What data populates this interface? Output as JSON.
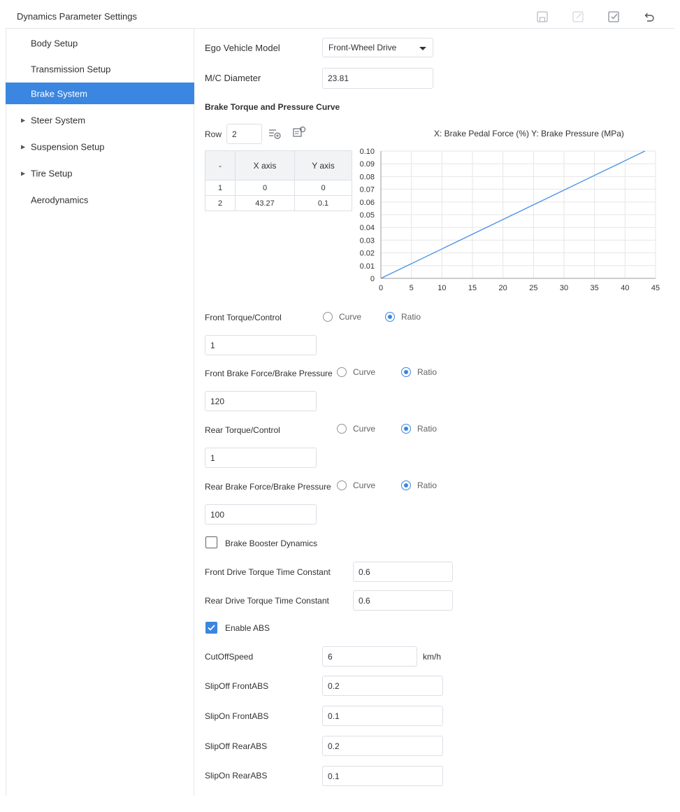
{
  "header": {
    "title": "Dynamics Parameter Settings",
    "icons": [
      "save-icon",
      "edit-icon",
      "confirm-icon",
      "undo-icon"
    ]
  },
  "sidebar": {
    "items": [
      {
        "label": "Body Setup",
        "expandable": false,
        "active": false
      },
      {
        "label": "Transmission Setup",
        "expandable": false,
        "active": false
      },
      {
        "label": "Brake System",
        "expandable": false,
        "active": true
      },
      {
        "label": "Steer System",
        "expandable": true,
        "active": false
      },
      {
        "label": "Suspension Setup",
        "expandable": true,
        "active": false
      },
      {
        "label": "Tire Setup",
        "expandable": true,
        "active": false
      },
      {
        "label": "Aerodynamics",
        "expandable": false,
        "active": false
      }
    ]
  },
  "form": {
    "ego_model": {
      "label": "Ego Vehicle Model",
      "value": "Front-Wheel Drive"
    },
    "mc_diameter": {
      "label": "M/C Diameter",
      "value": "23.81"
    },
    "curve_section": {
      "title": "Brake Torque and Pressure Curve",
      "row_label": "Row",
      "row_value": "2",
      "axis_caption": "X: Brake Pedal Force (%)  Y: Brake Pressure (MPa)",
      "table": {
        "headers": [
          "-",
          "X axis",
          "Y axis"
        ],
        "rows": [
          [
            "1",
            "0",
            "0"
          ],
          [
            "2",
            "43.27",
            "0.1"
          ]
        ]
      }
    },
    "front_torque": {
      "label": "Front Torque/Control",
      "curve": "Curve",
      "ratio": "Ratio",
      "selected": "ratio",
      "value": "1"
    },
    "front_brake_force": {
      "label": "Front Brake Force/Brake Pressure",
      "curve": "Curve",
      "ratio": "Ratio",
      "selected": "ratio",
      "value": "120"
    },
    "rear_torque": {
      "label": "Rear Torque/Control",
      "curve": "Curve",
      "ratio": "Ratio",
      "selected": "ratio",
      "value": "1"
    },
    "rear_brake_force": {
      "label": "Rear Brake Force/Brake Pressure",
      "curve": "Curve",
      "ratio": "Ratio",
      "selected": "ratio",
      "value": "100"
    },
    "booster": {
      "label": "Brake Booster Dynamics",
      "checked": false
    },
    "front_drive_tc": {
      "label": "Front Drive Torque Time Constant",
      "value": "0.6"
    },
    "rear_drive_tc": {
      "label": "Rear Drive Torque Time Constant",
      "value": "0.6"
    },
    "abs": {
      "label": "Enable ABS",
      "checked": true
    },
    "cutoff_speed": {
      "label": "CutOffSpeed",
      "value": "6",
      "unit": "km/h"
    },
    "slipoff_front": {
      "label": "SlipOff FrontABS",
      "value": "0.2"
    },
    "slipon_front": {
      "label": "SlipOn FrontABS",
      "value": "0.1"
    },
    "slipoff_rear": {
      "label": "SlipOff RearABS",
      "value": "0.2"
    },
    "slipon_rear": {
      "label": "SlipOn RearABS",
      "value": "0.1"
    }
  },
  "colors": {
    "accent": "#3a86e0",
    "line": "#4a90e2",
    "grid": "#e6e6e6"
  },
  "chart_data": {
    "type": "line",
    "title": "",
    "xlabel": "",
    "ylabel": "",
    "xlim": [
      0,
      45
    ],
    "ylim": [
      0,
      0.1
    ],
    "xticks": [
      "0",
      "5",
      "10",
      "15",
      "20",
      "25",
      "30",
      "35",
      "40",
      "45"
    ],
    "yticks": [
      "0",
      "0.01",
      "0.02",
      "0.03",
      "0.04",
      "0.05",
      "0.06",
      "0.07",
      "0.08",
      "0.09",
      "0.10"
    ],
    "grid": true,
    "series": [
      {
        "x": [
          0,
          43.27
        ],
        "y": [
          0,
          0.1
        ]
      }
    ]
  }
}
